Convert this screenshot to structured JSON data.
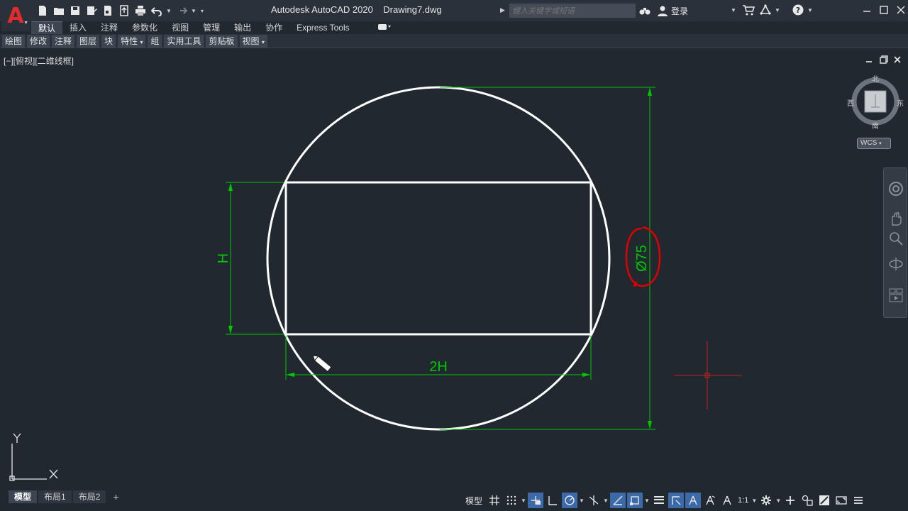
{
  "app": {
    "logo_letter": "A",
    "title": "Autodesk AutoCAD 2020    Drawing7.dwg"
  },
  "search": {
    "placeholder": "键入关键字或短语"
  },
  "account": {
    "login_label": "登录"
  },
  "ribbon": {
    "tabs": [
      "默认",
      "插入",
      "注释",
      "参数化",
      "视图",
      "管理",
      "输出",
      "协作",
      "Express Tools"
    ],
    "active_tab": "默认",
    "panels": [
      "绘图",
      "修改",
      "注释",
      "图层",
      "块",
      "特性",
      "组",
      "实用工具",
      "剪贴板",
      "视图"
    ]
  },
  "viewport": {
    "label": "[−][俯视][二维线框]"
  },
  "drawing": {
    "dimension_height": "H",
    "dimension_width": "2H",
    "dimension_diameter": "Ø75"
  },
  "viewcube": {
    "north": "北",
    "south": "南",
    "east": "东",
    "west": "西",
    "wcs": "WCS"
  },
  "ucs": {
    "x": "X",
    "y": "Y"
  },
  "layout_tabs": [
    "模型",
    "布局1",
    "布局2"
  ],
  "active_layout": "模型",
  "status": {
    "model_label": "模型",
    "scale": "1:1"
  },
  "colors": {
    "background": "#212830",
    "geometry": "#ffffff",
    "dimension": "#00c800",
    "crosshair": "#c81e1e",
    "annotation": "#e00000"
  }
}
